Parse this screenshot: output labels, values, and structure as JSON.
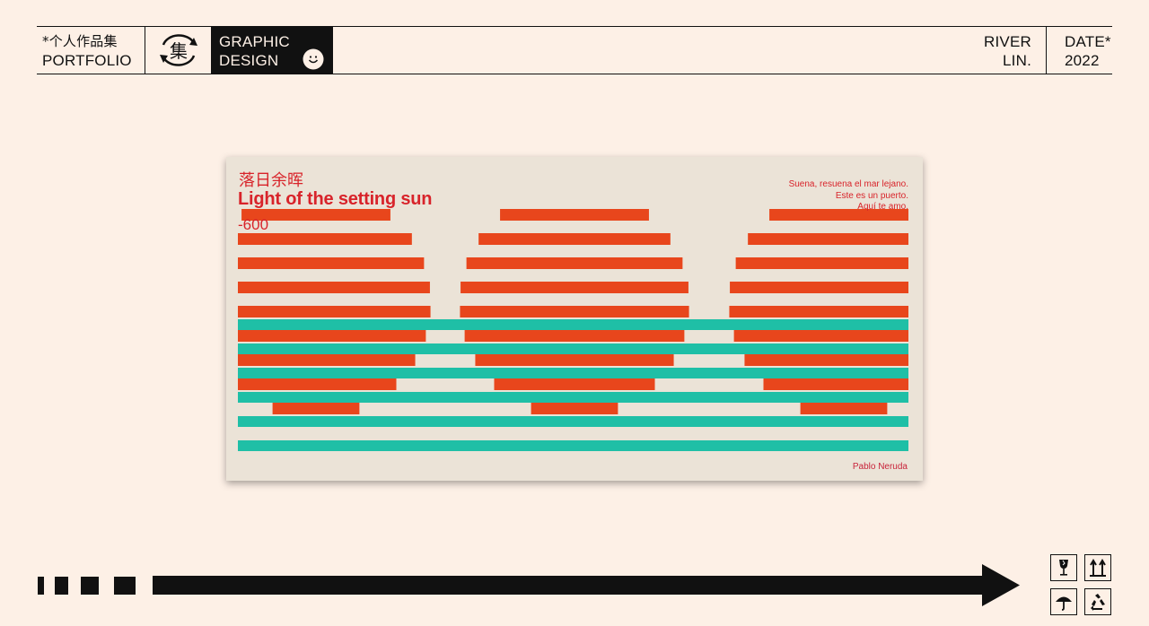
{
  "header": {
    "portfolio_cn": "*个人作品集",
    "portfolio_en": "PORTFOLIO",
    "logo_glyph": "集",
    "category_line1": "GRAPHIC",
    "category_line2": "DESIGN",
    "author_line1": "RIVER",
    "author_line2": "LIN.",
    "date_label": "DATE*",
    "date_year": "2022"
  },
  "poster": {
    "title_cn": "落日余晖",
    "title_en": "Light of the setting sun",
    "number": "-600",
    "quote": [
      "Suena, resuena el mar lejano.",
      "Este es un puerto.",
      "Aquí te amo."
    ],
    "author": "Pablo Neruda",
    "colors": {
      "background": "#ebe3d7",
      "sun": "#e8461c",
      "sea": "#1fbfa6",
      "text": "#d8232a"
    }
  },
  "footer": {
    "arrow_color": "#111111",
    "icons": [
      "fragile-glass-icon",
      "this-side-up-icon",
      "keep-dry-umbrella-icon",
      "recycle-icon"
    ]
  }
}
